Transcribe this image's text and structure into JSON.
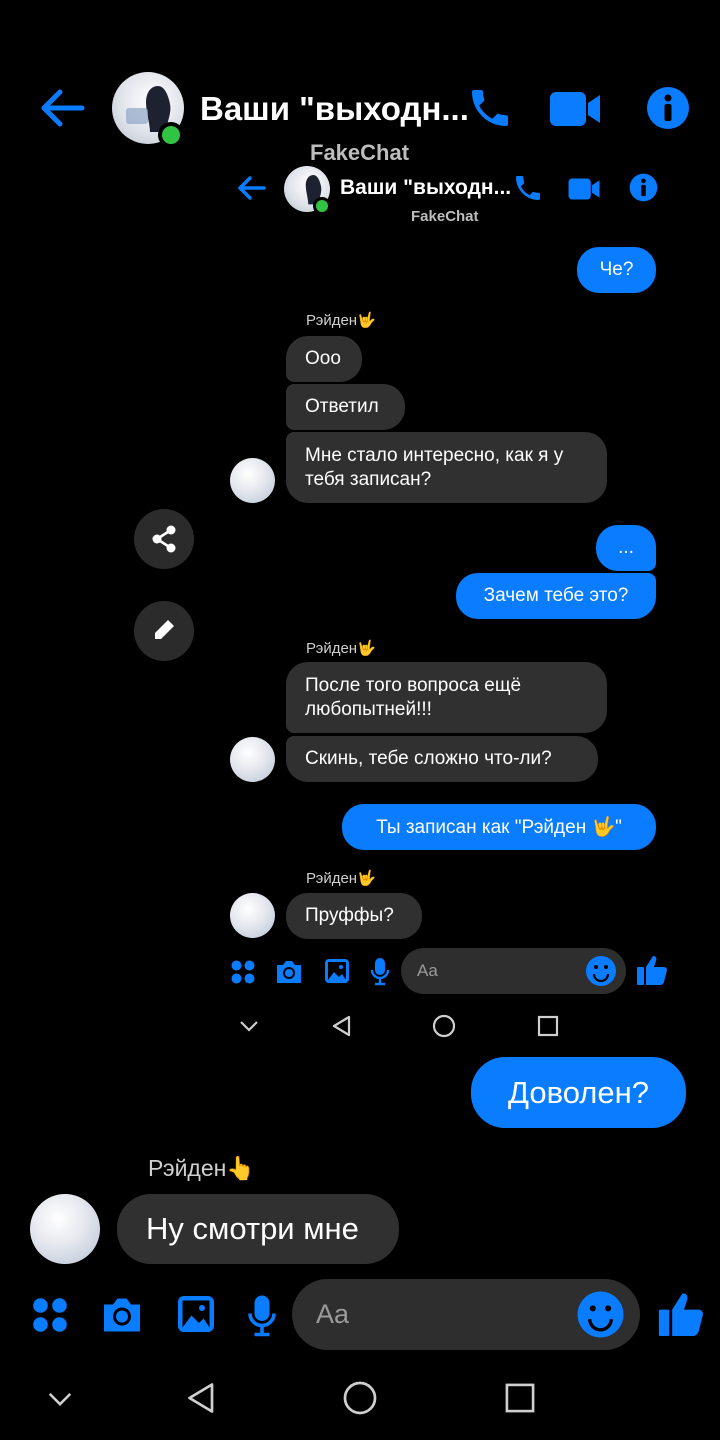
{
  "outer": {
    "header": {
      "title": "Ваши \"выходн...",
      "subtitle": "FakeChat"
    },
    "messages": {
      "out1": "Доволен?",
      "sender": "Рэйден👆",
      "in1": "Ну смотри мне"
    },
    "composer": {
      "placeholder": "Aa"
    }
  },
  "inner": {
    "header": {
      "title": "Ваши \"выходн...",
      "subtitle": "FakeChat"
    },
    "messages": {
      "out_che": "Че?",
      "sender1": "Рэйден🤟",
      "in_ooo": "Ооо",
      "in_otvetil": "Ответил",
      "in_interesno": "Мне стало интересно, как я у тебя записан?",
      "out_dots": "...",
      "out_zachem": "Зачем тебе это?",
      "sender2": "Рэйден🤟",
      "in_posle": "После того вопроса ещё любопытней!!!",
      "in_skin": "Скинь, тебе сложно что-ли?",
      "out_zapisan": "Ты записан как \"Рэйден 🤟\"",
      "sender3": "Рэйден🤟",
      "in_pruffy": "Пруффы?"
    },
    "composer": {
      "placeholder": "Aa"
    }
  },
  "colors": {
    "accent": "#0a7cff",
    "incoming_bubble": "#303030",
    "background": "#000000",
    "online": "#31c443"
  }
}
